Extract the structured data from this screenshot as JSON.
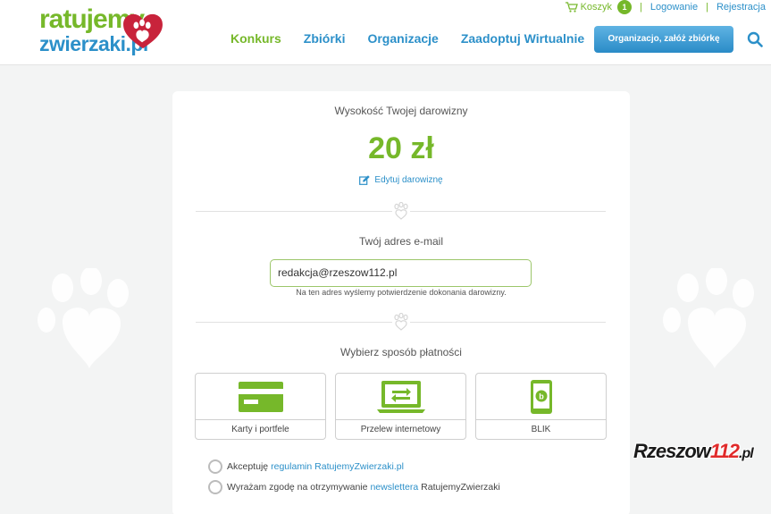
{
  "header": {
    "logo_line1": "ratujemy",
    "logo_line2": "zwierzaki.pl",
    "cart_label": "Koszyk",
    "cart_count": "1",
    "login_label": "Logowanie",
    "register_label": "Rejestracja",
    "separator": "|",
    "nav": [
      {
        "label": "Konkurs"
      },
      {
        "label": "Zbiórki"
      },
      {
        "label": "Organizacje"
      },
      {
        "label": "Zaadoptuj Wirtualnie"
      }
    ],
    "cta_label": "Organizacjo, załóż zbiórkę"
  },
  "donation": {
    "title": "Wysokość Twojej darowizny",
    "amount": "20 zł",
    "edit_label": "Edytuj darowiznę"
  },
  "email": {
    "title": "Twój adres e-mail",
    "value": "redakcja@rzeszow112.pl",
    "note": "Na ten adres wyślemy potwierdzenie dokonania darowizny."
  },
  "payment": {
    "title": "Wybierz sposób płatności",
    "options": [
      {
        "label": "Karty i portfele",
        "icon": "credit-card-icon"
      },
      {
        "label": "Przelew internetowy",
        "icon": "bank-transfer-icon"
      },
      {
        "label": "BLIK",
        "icon": "blik-phone-icon"
      }
    ]
  },
  "consents": {
    "terms_prefix": "Akceptuję",
    "terms_link": "regulamin RatujemyZwierzaki.pl",
    "newsletter_prefix": "Wyrażam zgodę na otrzymywanie",
    "newsletter_link": "newslettera",
    "newsletter_suffix": "RatujemyZwierzaki"
  },
  "watermark": {
    "part1": "Rzeszow",
    "part2": "112",
    "part3": ".pl"
  },
  "colors": {
    "brand_green": "#76b82a",
    "brand_blue": "#2c90c9",
    "heart_red": "#c8233b"
  }
}
